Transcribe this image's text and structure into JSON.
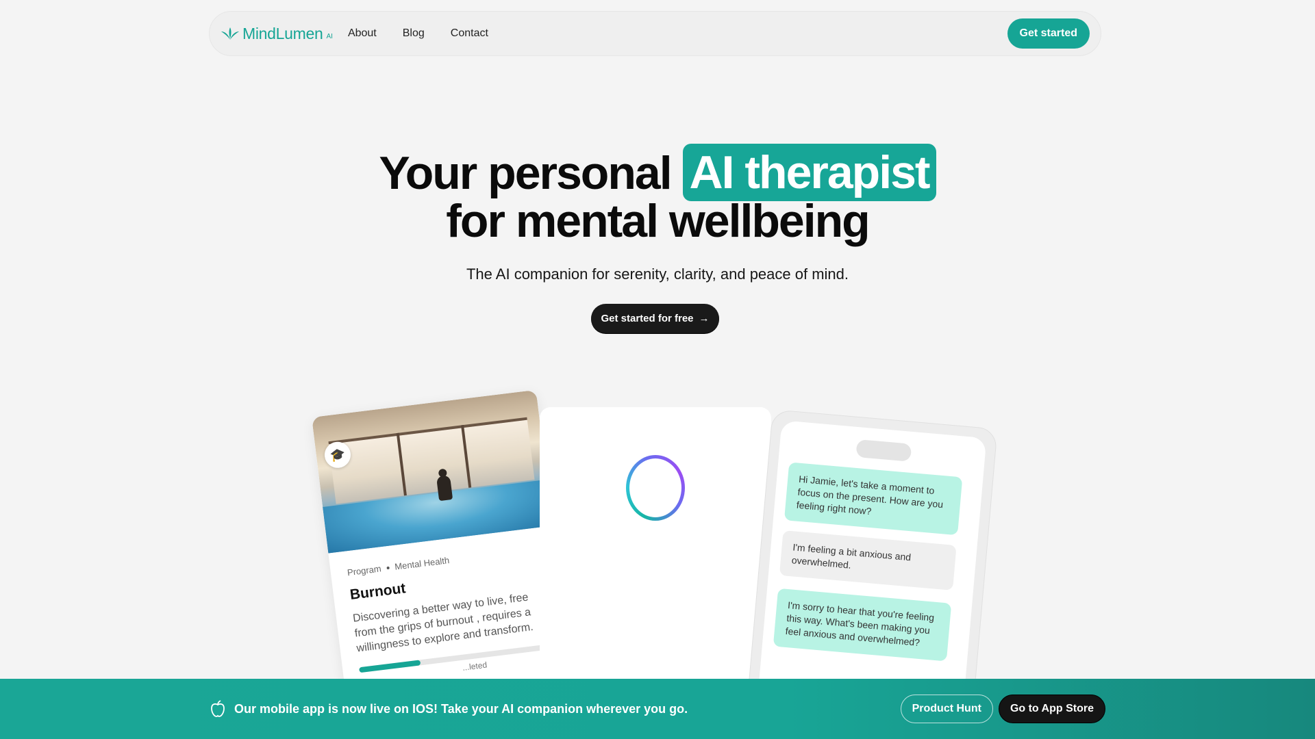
{
  "colors": {
    "accent": "#16a595",
    "page_bg": "#f4f4f4",
    "dark": "#151515",
    "ai_bubble": "#b8f3e4",
    "user_bubble": "#efefef"
  },
  "nav": {
    "brand_name": "MindLumen",
    "brand_suffix": "AI",
    "logo_icon": "lotus-leaves-icon",
    "links": [
      "About",
      "Blog",
      "Contact"
    ],
    "cta_label": "Get started"
  },
  "hero": {
    "title_prefix": "Your personal",
    "title_highlight": "AI therapist",
    "title_line2": "for mental wellbeing",
    "subtitle": "The AI companion for serenity, clarity, and peace of mind.",
    "cta_label": "Get started for free",
    "cta_icon": "arrow-right-icon"
  },
  "program_card": {
    "badge_icon": "graduation-cap-icon",
    "meta_type": "Program",
    "meta_category": "Mental Health",
    "title": "Burnout",
    "description": "Discovering a better way to live, free from the grips of burnout , requires a willingness to explore and transform.",
    "progress_fraction": 0.3,
    "progress_label": "...leted"
  },
  "breathing_card": {
    "ring_icon": "breathing-ring-icon"
  },
  "chat": {
    "messages": [
      {
        "role": "ai",
        "text": "Hi Jamie, let's take a moment to focus on the present. How are you feeling right now?"
      },
      {
        "role": "user",
        "text": "I'm feeling a bit anxious and overwhelmed."
      },
      {
        "role": "ai",
        "text": "I'm sorry to hear that you're feeling this way. What's been making you feel anxious and overwhelmed?"
      }
    ]
  },
  "banner": {
    "icon": "apple-icon",
    "text": "Our mobile app is now live on IOS! Take your AI companion wherever you go.",
    "product_hunt_label": "Product Hunt",
    "app_store_label": "Go to App Store"
  }
}
